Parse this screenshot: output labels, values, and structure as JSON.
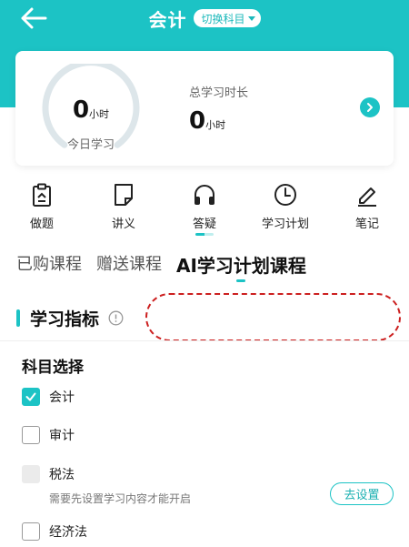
{
  "header": {
    "title": "会计",
    "switch_label": "切换科目",
    "bg_color": "#1cc3c5"
  },
  "stats": {
    "today_value": "0",
    "today_unit": "小时",
    "today_label": "今日学习",
    "total_label": "总学习时长",
    "total_value": "0",
    "total_unit": "小时"
  },
  "tools": [
    {
      "label": "做题",
      "icon": "clipboard-icon"
    },
    {
      "label": "讲义",
      "icon": "document-icon"
    },
    {
      "label": "答疑",
      "icon": "headphones-icon"
    },
    {
      "label": "学习计划",
      "icon": "clock-icon"
    },
    {
      "label": "笔记",
      "icon": "pencil-icon"
    }
  ],
  "tabs": [
    {
      "label": "已购课程",
      "active": false
    },
    {
      "label": "赠送课程",
      "active": false
    },
    {
      "label": "AI学习计划课程",
      "active": true
    }
  ],
  "metrics": {
    "title": "学习指标"
  },
  "subjects": {
    "title": "科目选择",
    "items": [
      {
        "label": "会计",
        "state": "checked"
      },
      {
        "label": "审计",
        "state": "unchecked"
      },
      {
        "label": "税法",
        "state": "disabled"
      },
      {
        "label": "经济法",
        "state": "unchecked"
      }
    ],
    "hint": "需要先设置学习内容才能开启",
    "setup_button": "去设置"
  }
}
